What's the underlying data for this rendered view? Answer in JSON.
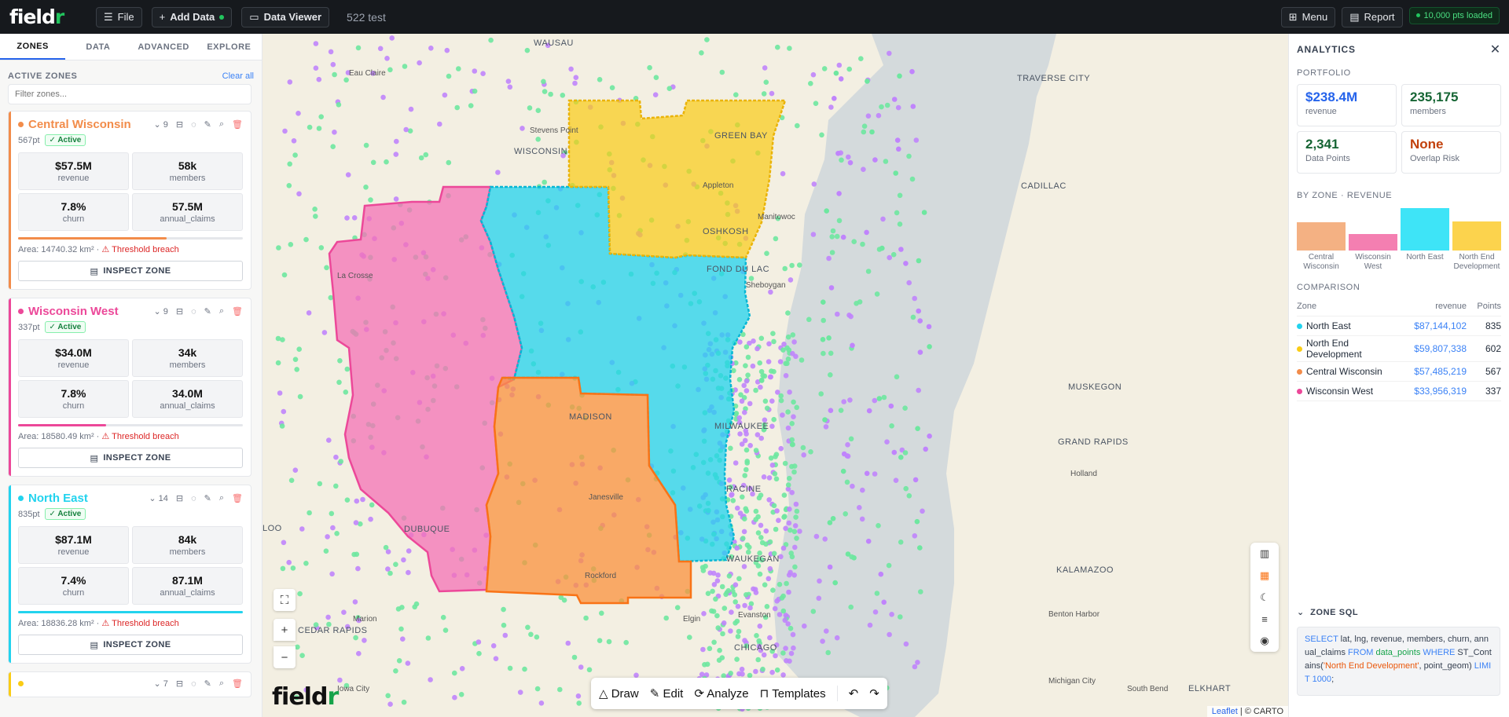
{
  "topbar": {
    "logo": "field",
    "logo_accent": "r",
    "file": "File",
    "add_data": "Add Data",
    "data_viewer": "Data Viewer",
    "project": "522 test",
    "menu": "Menu",
    "report": "Report",
    "loaded": "10,000 pts loaded"
  },
  "left": {
    "tabs": [
      "ZONES",
      "DATA",
      "ADVANCED",
      "EXPLORE"
    ],
    "active_zones": "ACTIVE ZONES",
    "clear_all": "Clear all",
    "filter_placeholder": "Filter zones...",
    "inspect": "INSPECT ZONE",
    "zones": [
      {
        "name": "Central Wisconsin",
        "color": "#f28c4a",
        "pts": "567pt",
        "count": "9",
        "status": "✓ Active",
        "revenue": "$57.5M",
        "members": "58k",
        "churn": "7.8%",
        "annual_claims": "57.5M",
        "progress": 0.66,
        "area": "Area: 14740.32 km²",
        "breach": "⚠ Threshold breach"
      },
      {
        "name": "Wisconsin West",
        "color": "#ec4899",
        "pts": "337pt",
        "count": "9",
        "status": "✓ Active",
        "revenue": "$34.0M",
        "members": "34k",
        "churn": "7.8%",
        "annual_claims": "34.0M",
        "progress": 0.39,
        "area": "Area: 18580.49 km²",
        "breach": "⚠ Threshold breach"
      },
      {
        "name": "North East",
        "color": "#22d3ee",
        "pts": "835pt",
        "count": "14",
        "status": "✓ Active",
        "revenue": "$87.1M",
        "members": "84k",
        "churn": "7.4%",
        "annual_claims": "87.1M",
        "progress": 1.0,
        "area": "Area: 18836.28 km²",
        "breach": "⚠ Threshold breach"
      },
      {
        "count": "7",
        "color": "#facc15"
      }
    ],
    "labels": {
      "revenue": "revenue",
      "members": "members",
      "churn": "churn",
      "annual_claims": "annual_claims"
    }
  },
  "map": {
    "places": [
      {
        "name": "WAUSAU"
      },
      {
        "name": "Eau Claire"
      },
      {
        "name": "Stevens Point"
      },
      {
        "name": "WISCONSIN"
      },
      {
        "name": "GREEN BAY"
      },
      {
        "name": "Appleton"
      },
      {
        "name": "Manitowoc"
      },
      {
        "name": "OSHKOSH"
      },
      {
        "name": "La Crosse"
      },
      {
        "name": "FOND DU LAC"
      },
      {
        "name": "Sheboygan"
      },
      {
        "name": "MADISON"
      },
      {
        "name": "MILWAUKEE"
      },
      {
        "name": "RACINE"
      },
      {
        "name": "Janesville"
      },
      {
        "name": "DUBUQUE"
      },
      {
        "name": "Rockford"
      },
      {
        "name": "WAUKEGAN"
      },
      {
        "name": "Elgin"
      },
      {
        "name": "Evanston"
      },
      {
        "name": "CHICAGO"
      },
      {
        "name": "Marion"
      },
      {
        "name": "CEDAR RAPIDS"
      },
      {
        "name": "Iowa City"
      },
      {
        "name": "TRAVERSE CITY"
      },
      {
        "name": "CADILLAC"
      },
      {
        "name": "MUSKEGON"
      },
      {
        "name": "GRAND RAPIDS"
      },
      {
        "name": "Holland"
      },
      {
        "name": "KALAMAZOO"
      },
      {
        "name": "Benton Harbor"
      },
      {
        "name": "Michigan City"
      },
      {
        "name": "South Bend"
      },
      {
        "name": "ELKHART"
      },
      {
        "name": "LOO"
      }
    ],
    "logo": "field",
    "logo_accent": "r",
    "tools": [
      "Draw",
      "Edit",
      "Analyze",
      "Templates"
    ],
    "attribution_link": "Leaflet",
    "attribution_rest": " | © CARTO",
    "zoom_in": "+",
    "zoom_out": "−"
  },
  "analytics": {
    "title": "ANALYTICS",
    "portfolio": "PORTFOLIO",
    "kpis": [
      {
        "value": "$238.4M",
        "label": "revenue",
        "color": "#2563eb"
      },
      {
        "value": "235,175",
        "label": "members",
        "color": "#166534"
      },
      {
        "value": "2,341",
        "label": "Data Points",
        "color": "#166534"
      },
      {
        "value": "None",
        "label": "Overlap Risk",
        "color": "#c2410c"
      }
    ],
    "by_zone": "BY ZONE · REVENUE",
    "chart_data": {
      "type": "bar",
      "categories": [
        "Central Wisconsin",
        "Wisconsin West",
        "North East",
        "North End Development"
      ],
      "values": [
        57485219,
        33956319,
        87144102,
        59807338
      ],
      "colors": [
        "#f4b183",
        "#f47fb1",
        "#3ee4f7",
        "#fcd34d"
      ]
    },
    "comparison": "COMPARISON",
    "cols": [
      "Zone",
      "revenue",
      "Points"
    ],
    "rows": [
      {
        "zone": "North East",
        "color": "#22d3ee",
        "revenue": "$87,144,102",
        "points": "835"
      },
      {
        "zone": "North End Development",
        "color": "#facc15",
        "revenue": "$59,807,338",
        "points": "602"
      },
      {
        "zone": "Central Wisconsin",
        "color": "#f28c4a",
        "revenue": "$57,485,219",
        "points": "567"
      },
      {
        "zone": "Wisconsin West",
        "color": "#ec4899",
        "revenue": "$33,956,319",
        "points": "337"
      }
    ],
    "sql_title": "ZONE SQL",
    "sql": {
      "k1": "SELECT",
      "t1": " lat, lng, revenue, members, churn, annual_claims ",
      "k2": "FROM",
      "k3": " data_points ",
      "k4": "WHERE",
      "t2": " ST_Contains(",
      "s1": "'North End Development'",
      "t3": ", point_geom) ",
      "k5": "LIMIT 1000",
      "t4": ";"
    }
  }
}
